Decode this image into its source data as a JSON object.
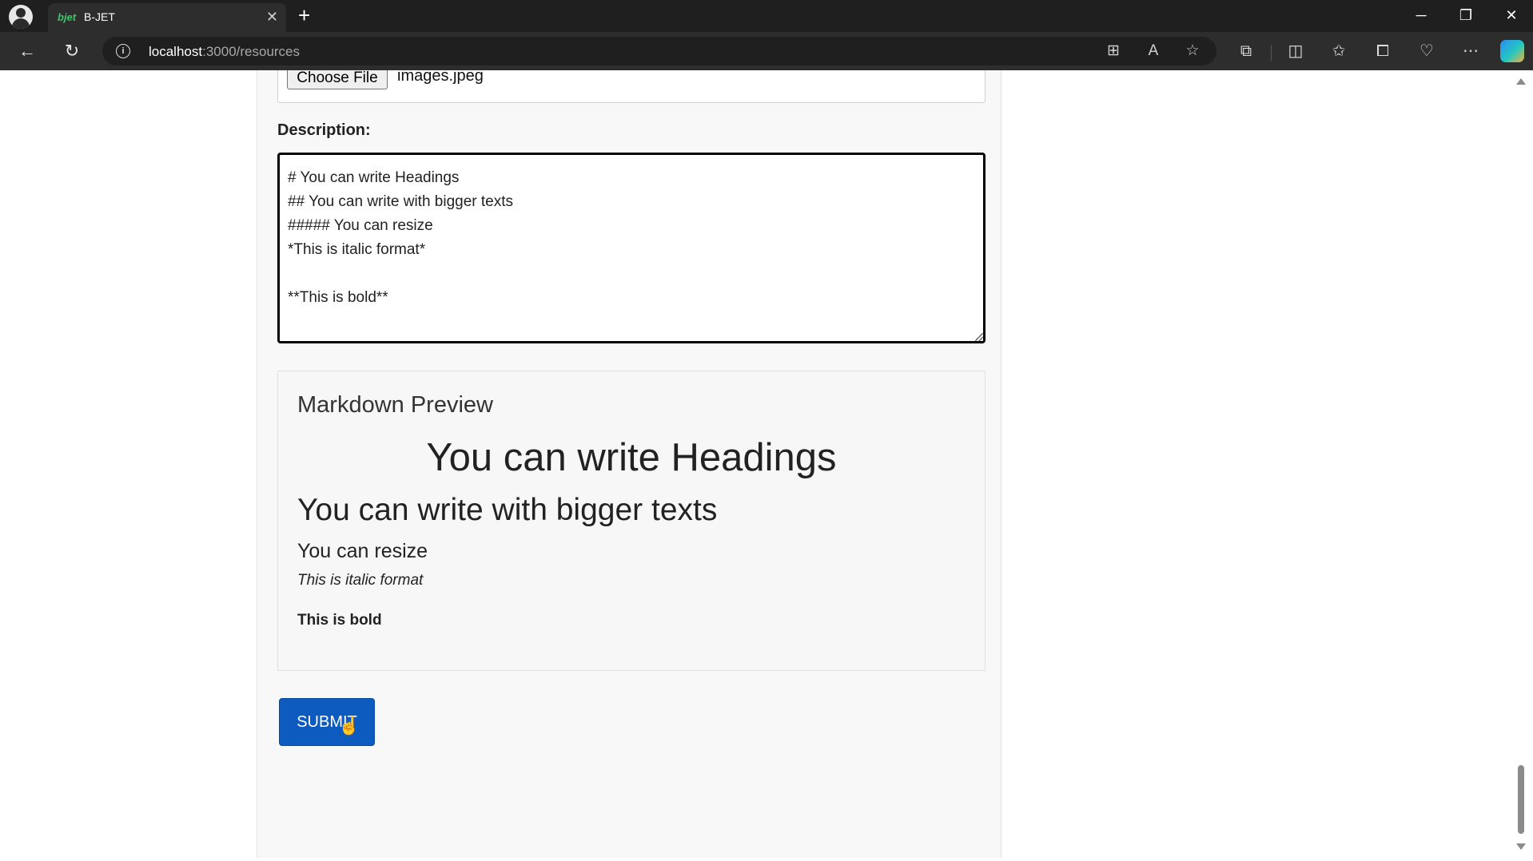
{
  "browser": {
    "tab_title": "B-JET",
    "tab_favicon_text": "bjet",
    "url_host": "localhost",
    "url_path": ":3000/resources",
    "new_tab_symbol": "+",
    "close_tab_symbol": "✕"
  },
  "form": {
    "file_button_label": "Choose File",
    "file_name": "images.jpeg",
    "description_label": "Description:",
    "description_value": "# You can write Headings\n## You can write with bigger texts\n##### You can resize\n*This is italic format*\n\n**This is bold**",
    "submit_label": "SUBMIT"
  },
  "preview": {
    "title": "Markdown Preview",
    "h1": "You can write Headings",
    "h2": "You can write with bigger texts",
    "h5": "You can resize",
    "italic": "This is italic format",
    "bold": "This is bold"
  },
  "icons": {
    "back": "back-arrow-icon",
    "refresh": "refresh-icon",
    "info": "info-icon",
    "favorite": "star-icon",
    "extensions": "puzzle-icon",
    "more": "more-icon",
    "copilot": "copilot-icon"
  }
}
